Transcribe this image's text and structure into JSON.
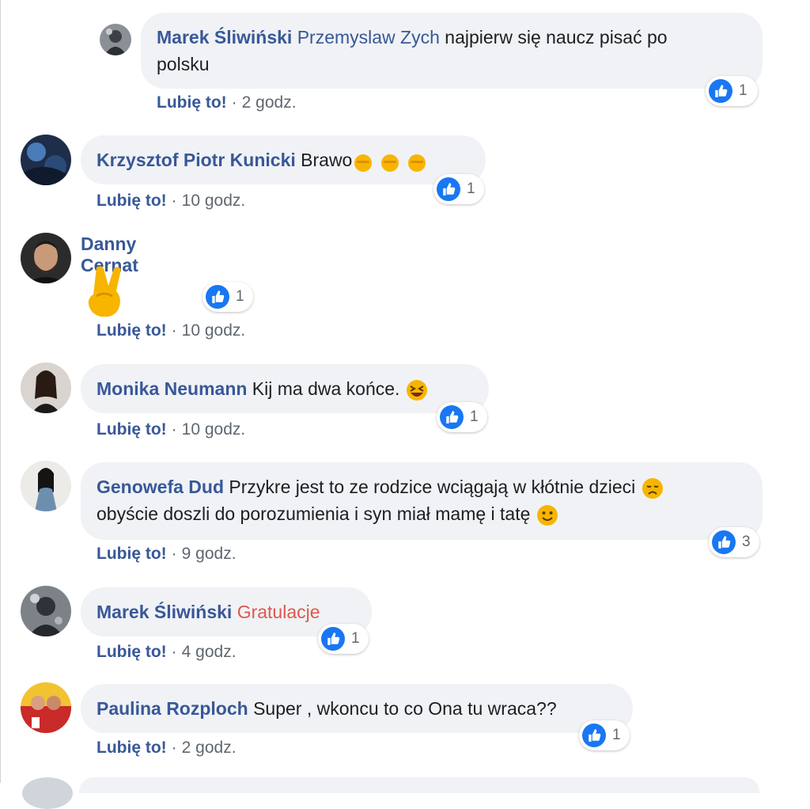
{
  "like_label": "Lubię to!",
  "comments": [
    {
      "author": "Marek Śliwiński",
      "mention": "Przemyslaw Zych",
      "text_line1": " najpierw się naucz pisać po",
      "text_line2": "polsku",
      "time": "2 godz.",
      "likes": "1"
    },
    {
      "author": "Krzysztof Piotr Kunicki",
      "text": " Brawo",
      "time": "10 godz.",
      "likes": "1"
    },
    {
      "author": "Danny Cernat",
      "time": "10 godz.",
      "likes": "1"
    },
    {
      "author": "Monika Neumann",
      "text": " Kij ma dwa końce.",
      "time": "10 godz.",
      "likes": "1"
    },
    {
      "author": "Genowefa Dud",
      "text_line1": " Przykre jest to ze rodzice wciągają w kłótnie dzieci",
      "text_line2": "obyście doszli do porozumienia i syn miał mamę i tatę",
      "time": "9 godz.",
      "likes": "3"
    },
    {
      "author": "Marek Śliwiński",
      "mention": "Gratulacje",
      "time": "4 godz.",
      "likes": "1"
    },
    {
      "author": "Paulina Rozploch",
      "text": " Super , wkoncu to co Ona tu wraca??",
      "time": "2 godz.",
      "likes": "1"
    }
  ],
  "icons": {
    "like": "thumbs-up-icon",
    "clap": "clapping-hands-emoji",
    "peace": "victory-hand-emoji",
    "squint": "grinning-squinting-emoji",
    "disappointed": "disappointed-face-emoji",
    "smile": "slightly-smiling-face-emoji"
  },
  "colors": {
    "name": "#385898",
    "bubble": "#f0f2f5",
    "like_badge": "#1877f2",
    "mention_red": "#e0584c"
  }
}
